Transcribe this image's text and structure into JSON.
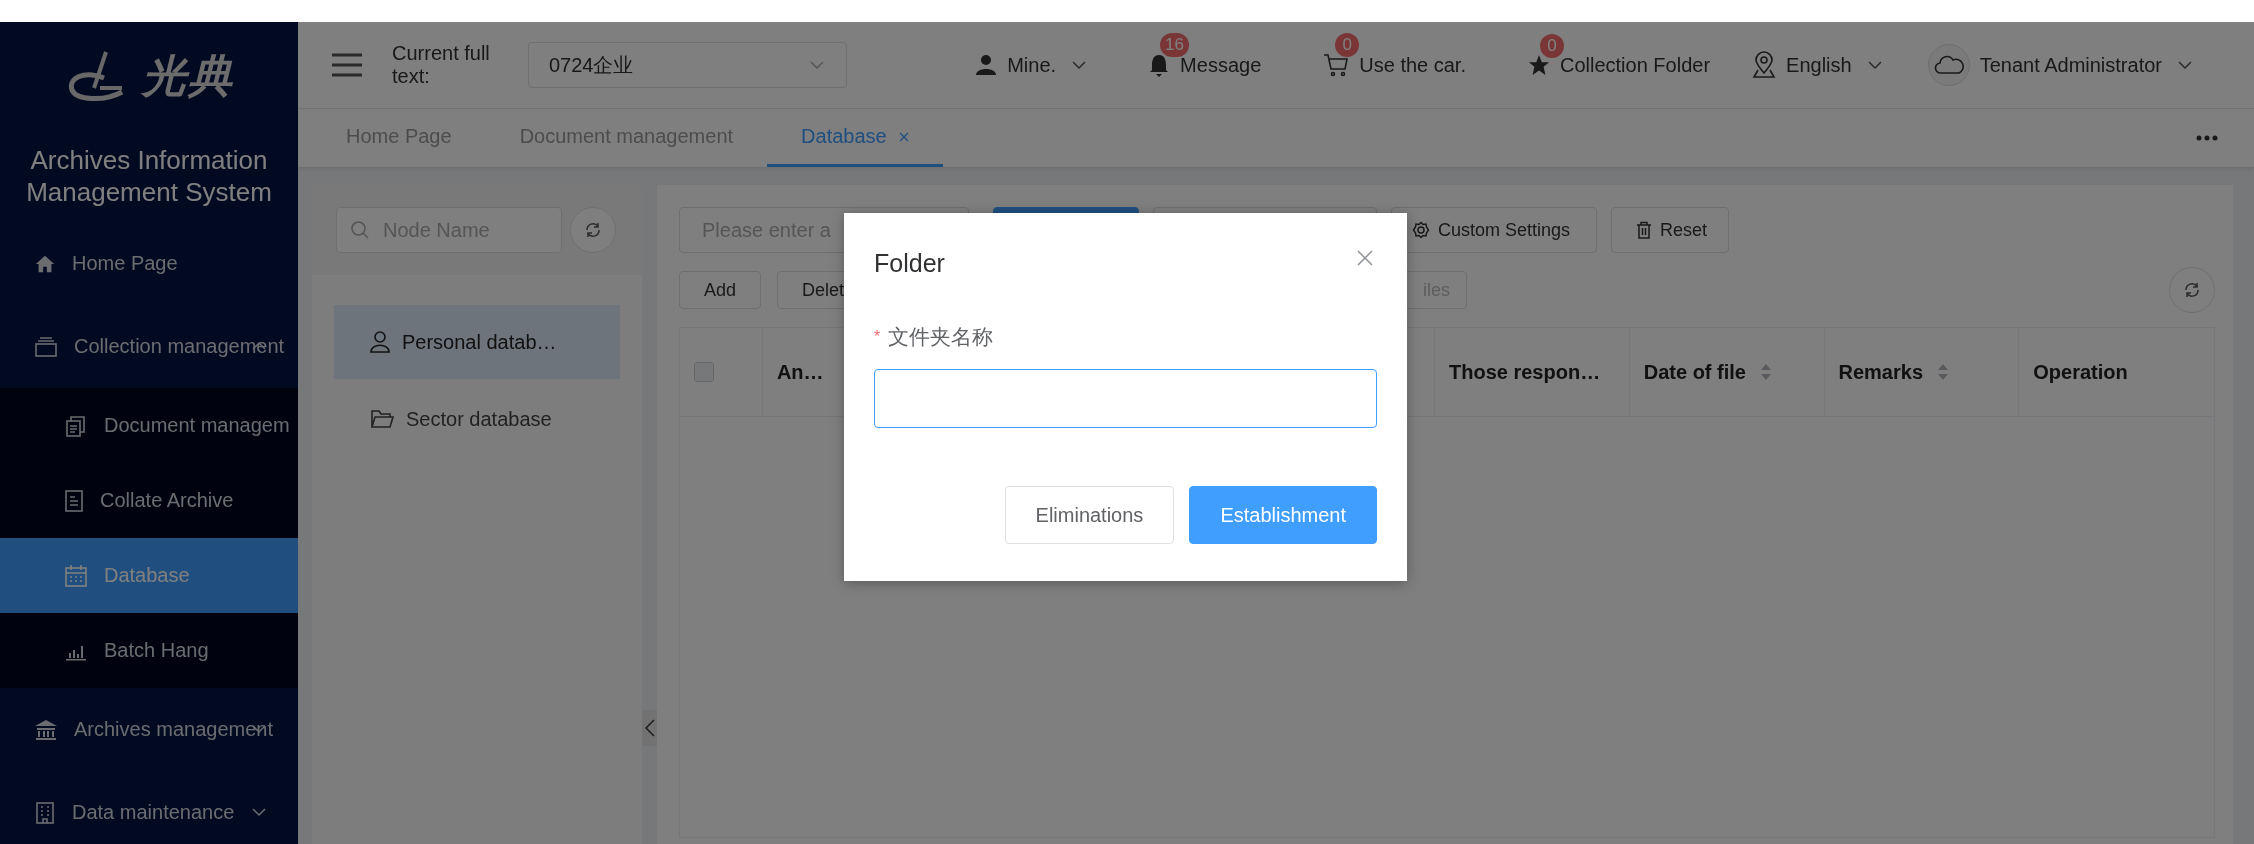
{
  "sidebar": {
    "logo_text": "光典",
    "title": "Archives Information Management System",
    "items": [
      {
        "label": "Home Page",
        "selected": false
      },
      {
        "label": "Collection management",
        "selected": false,
        "expanded": true,
        "children": [
          {
            "label": "Document managem",
            "selected": false
          },
          {
            "label": "Collate Archive",
            "selected": false
          },
          {
            "label": "Database",
            "selected": true
          },
          {
            "label": "Batch Hang",
            "selected": false
          }
        ]
      },
      {
        "label": "Archives management",
        "selected": false,
        "expanded": false
      },
      {
        "label": "Data maintenance",
        "selected": false,
        "expanded": false
      }
    ]
  },
  "header": {
    "current_full_text": {
      "label": "Current full text:",
      "value": "0724企业"
    },
    "actions": [
      {
        "label": "Mine.",
        "dropdown": true
      },
      {
        "label": "Message",
        "badge": "16",
        "dropdown": false
      },
      {
        "label": "Use the car.",
        "badge": "0",
        "dropdown": false
      },
      {
        "label": "Collection Folder",
        "badge": "0",
        "dropdown": false
      },
      {
        "label": "English",
        "dropdown": true
      },
      {
        "label": "Tenant Administrator",
        "dropdown": true
      }
    ]
  },
  "tabs": [
    {
      "label": "Home Page",
      "selected": false,
      "closable": false
    },
    {
      "label": "Document management",
      "selected": false,
      "closable": false
    },
    {
      "label": "Database",
      "selected": true,
      "closable": true
    }
  ],
  "tree": {
    "search": {
      "placeholder": "Node Name"
    },
    "items": [
      {
        "label": "Personal datab…",
        "selected": true
      },
      {
        "label": "Sector database",
        "selected": false
      }
    ]
  },
  "toolbar": {
    "search": {
      "placeholder": "Please enter a"
    },
    "buttons": [
      {
        "kind": "primary"
      },
      {
        "kind": "default"
      },
      {
        "kind": "default",
        "label": "Custom Settings"
      },
      {
        "kind": "default",
        "label": "Reset"
      }
    ],
    "actions": [
      {
        "label": "Add",
        "disabled": false
      },
      {
        "label": "Delet",
        "disabled": false
      },
      {
        "label": "iles",
        "disabled": true
      }
    ]
  },
  "table": {
    "select_all": {
      "checked": false
    },
    "columns": [
      {
        "label": "An…",
        "sortable": false
      },
      {
        "label": "Those respon…",
        "sortable": false
      },
      {
        "label": "Date of file",
        "sortable": true
      },
      {
        "label": "Remarks",
        "sortable": true
      },
      {
        "label": "Operation",
        "sortable": false
      }
    ]
  },
  "dialog": {
    "title": "Folder",
    "field": {
      "label": "文件夹名称",
      "required_mark": "*",
      "focused": true
    },
    "buttons": [
      {
        "label": "Eliminations",
        "kind": "default"
      },
      {
        "label": "Establishment",
        "kind": "primary"
      }
    ]
  }
}
